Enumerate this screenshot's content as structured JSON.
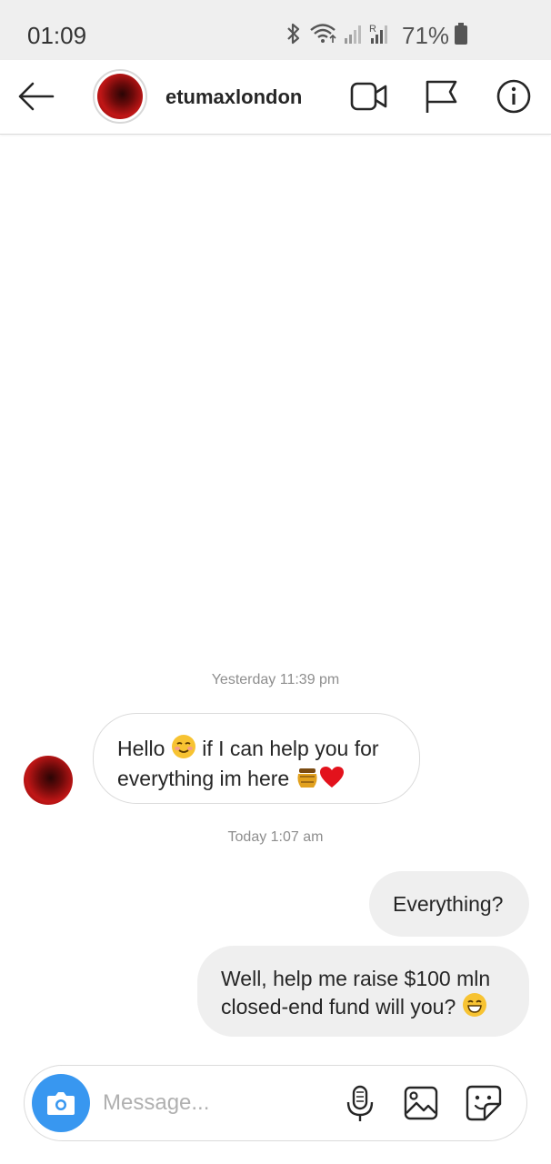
{
  "status_bar": {
    "time": "01:09",
    "battery": "71%",
    "icons": [
      "bluetooth-icon",
      "wifi-icon",
      "signal-icon",
      "signal-roaming-icon",
      "battery-icon"
    ]
  },
  "header": {
    "username": "etumaxlondon",
    "icons": [
      "back-arrow-icon",
      "video-call-icon",
      "flag-icon",
      "info-icon"
    ]
  },
  "messages": [
    {
      "type": "timestamp",
      "text": "Yesterday 11:39 pm"
    },
    {
      "type": "incoming",
      "lines": [
        "Hello ☺️ if I can help you for",
        "everything im here 🍯❤️"
      ],
      "line1_text": "Hello",
      "line1_rest": "if I can help you for",
      "line2_text": "everything im here"
    },
    {
      "type": "timestamp",
      "text": "Today 1:07 am"
    },
    {
      "type": "outgoing",
      "text": "Everything?"
    },
    {
      "type": "outgoing",
      "line1": "Well, help me raise $100 mln",
      "line2": "closed-end fund will you?"
    }
  ],
  "composer": {
    "placeholder": "Message...",
    "icons": [
      "camera-icon",
      "microphone-icon",
      "gallery-icon",
      "sticker-icon"
    ]
  },
  "colors": {
    "accent": "#3897f0",
    "bubble_outgoing": "#efefef",
    "bubble_border": "#dbdbdb",
    "timestamp": "#8e8e8e",
    "status_bar_bg": "#efefef"
  }
}
